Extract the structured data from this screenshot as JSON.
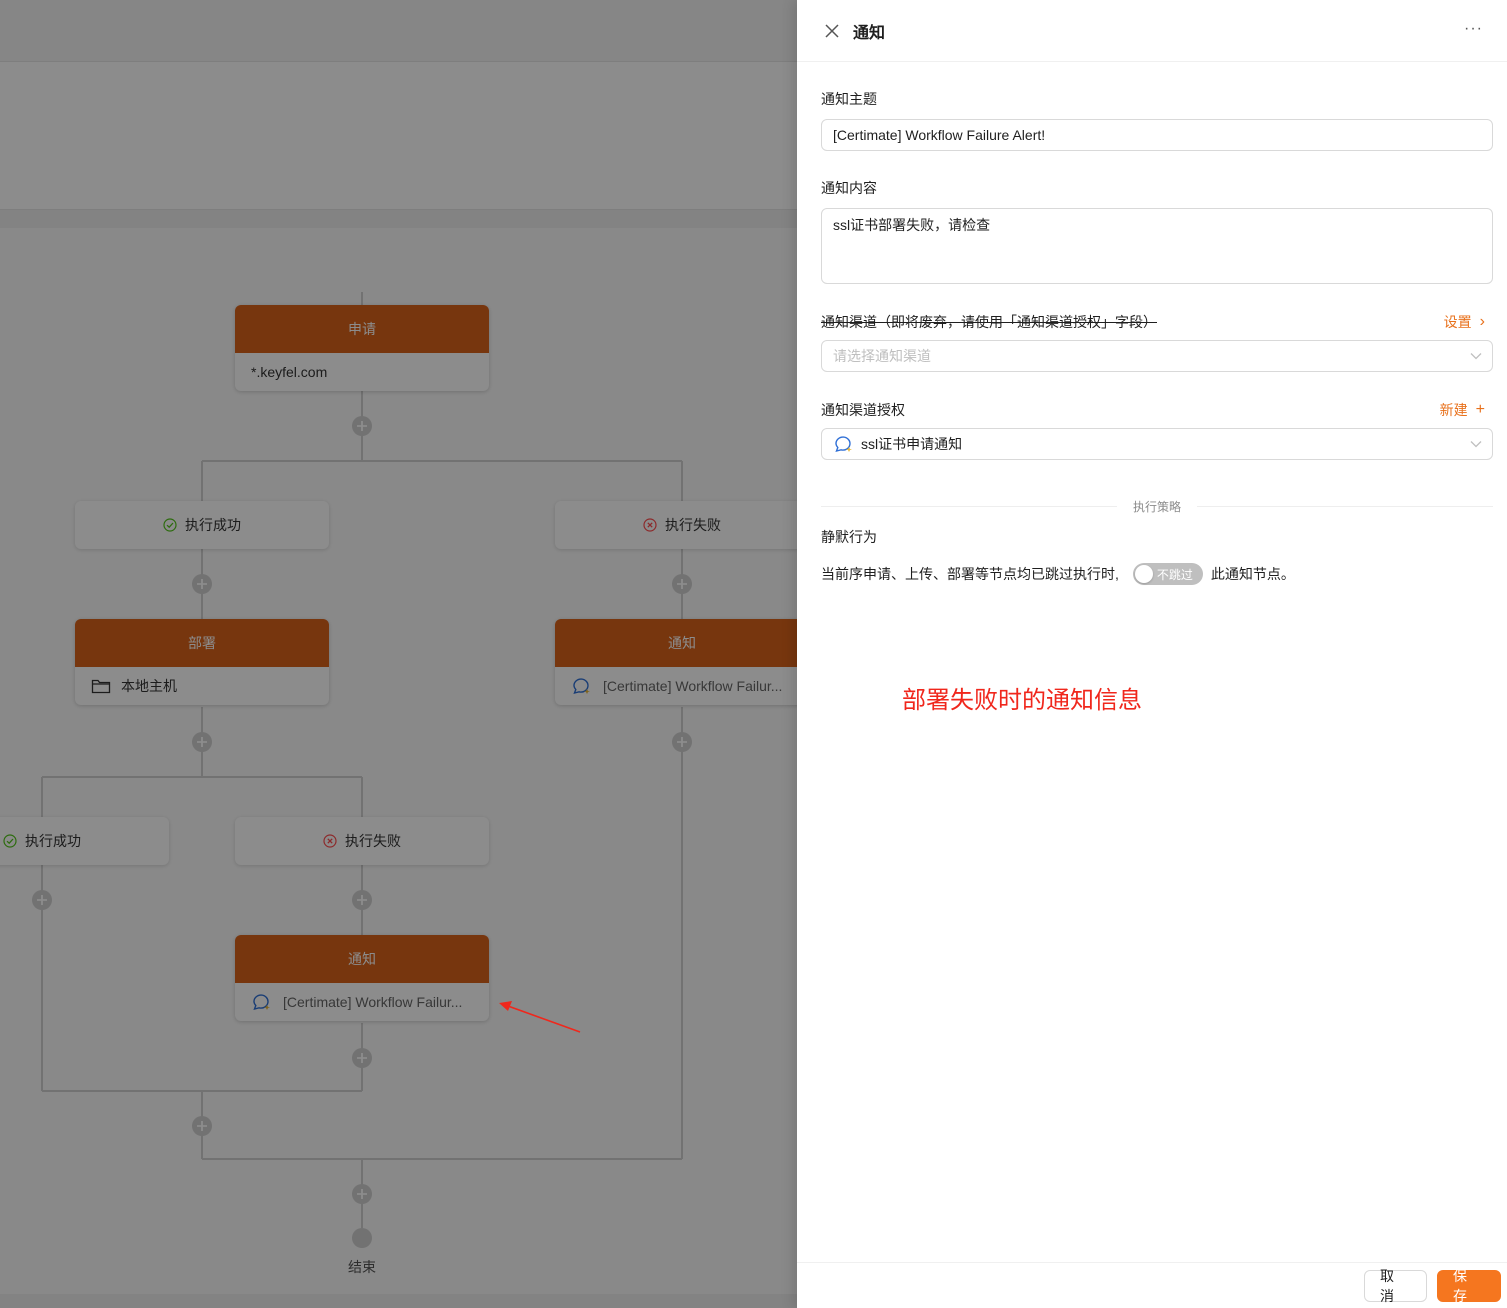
{
  "workflow": {
    "apply_node": {
      "title": "申请",
      "body": "*.keyfel.com"
    },
    "branch1": {
      "success_label": "执行成功",
      "fail_label": "执行失败"
    },
    "deploy_node": {
      "title": "部署",
      "body": "本地主机"
    },
    "notify_node_right": {
      "title": "通知",
      "body": "[Certimate] Workflow Failur..."
    },
    "branch2": {
      "success_label": "执行成功",
      "fail_label": "执行失败"
    },
    "notify_node_bottom": {
      "title": "通知",
      "body": "[Certimate] Workflow Failur..."
    },
    "end_label": "结束"
  },
  "drawer": {
    "title": "通知",
    "more": "···",
    "subject": {
      "label": "通知主题",
      "value": "[Certimate] Workflow Failure Alert!"
    },
    "content": {
      "label": "通知内容",
      "value": "ssl证书部署失败，请检查"
    },
    "channel": {
      "label": "通知渠道（即将废弃，请使用「通知渠道授权」字段）",
      "action": "设置",
      "action_glyph": "›",
      "placeholder": "请选择通知渠道"
    },
    "channel_auth": {
      "label": "通知渠道授权",
      "action": "新建",
      "action_glyph": "+",
      "value": "ssl证书申请通知"
    },
    "strategy_divider": "执行策略",
    "silent": {
      "label": "静默行为",
      "before": "当前序申请、上传、部署等节点均已跳过执行时,",
      "switch_text": "不跳过",
      "after": "此通知节点。"
    },
    "annotation": "部署失败时的通知信息",
    "footer": {
      "cancel": "取 消",
      "save": "保 存"
    }
  },
  "colors": {
    "accent": "#f5761f",
    "node_header": "#d9631a",
    "annotation": "#f0271c",
    "success": "#52c41a",
    "fail": "#ff4d4f"
  }
}
